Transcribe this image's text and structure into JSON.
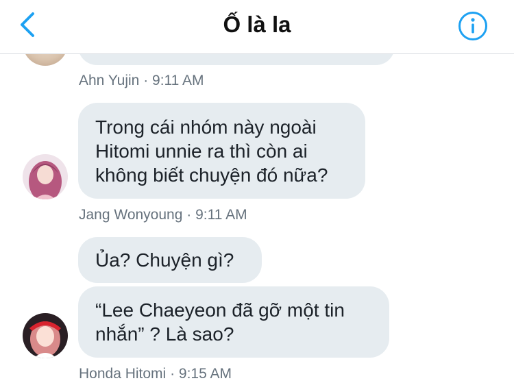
{
  "header": {
    "title": "Ố là la"
  },
  "messages": [
    {
      "sender": "Ahn Yujin",
      "time": "9:11 AM",
      "separator": "·",
      "text": ""
    },
    {
      "sender": "Jang Wonyoung",
      "time": "9:11 AM",
      "separator": "·",
      "lines": [
        "Trong cái nhóm này ngoài",
        "Hitomi unnie ra thì còn ai",
        "không biết chuyện đó nữa?"
      ]
    },
    {
      "sender": "Honda Hitomi",
      "time": "9:15 AM",
      "separator": "·",
      "bubbles": [
        {
          "lines": [
            "Ủa? Chuyện gì?"
          ]
        },
        {
          "lines": [
            "“Lee Chaeyeon đã gỡ một tin",
            "nhắn” ? Là sao?"
          ]
        }
      ]
    }
  ],
  "colors": {
    "accent": "#1da1f2",
    "bubble": "#e6ecf0",
    "meta_text": "#66727d"
  },
  "icons": {
    "back": "chevron-left-icon",
    "info": "info-icon"
  }
}
